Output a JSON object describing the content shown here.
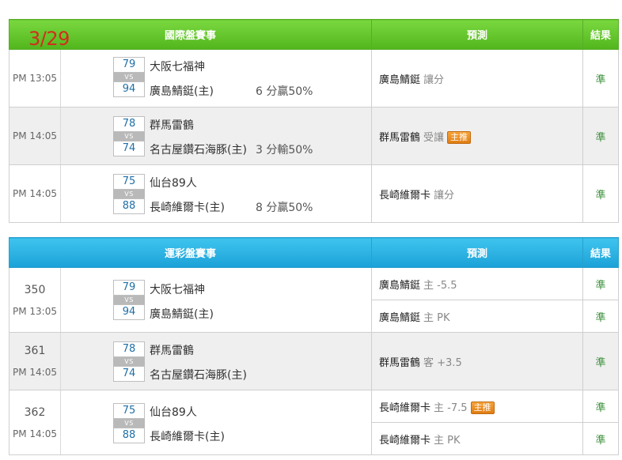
{
  "table1": {
    "date_mark": "3/29",
    "header": {
      "events": "國際盤賽事",
      "prediction": "預測",
      "result": "結果"
    },
    "rows": [
      {
        "time": "PM 13:05",
        "away_score": "79",
        "home_score": "94",
        "vs": "VS",
        "away": "大阪七福神",
        "home": "廣島鯖鋌(主)",
        "handicap": "6 分贏50%",
        "pick": "廣島鯖鋌",
        "pick_extra": "讓分",
        "badge": "",
        "result": "準"
      },
      {
        "time": "PM 14:05",
        "away_score": "78",
        "home_score": "74",
        "vs": "VS",
        "away": "群馬雷鶴",
        "home": "名古屋鑽石海豚(主)",
        "handicap": "3 分輸50%",
        "pick": "群馬雷鶴",
        "pick_extra": "受讓",
        "badge": "主推",
        "result": "準"
      },
      {
        "time": "PM 14:05",
        "away_score": "75",
        "home_score": "88",
        "vs": "VS",
        "away": "仙台89人",
        "home": "長崎維爾卡(主)",
        "handicap": "8 分贏50%",
        "pick": "長崎維爾卡",
        "pick_extra": "讓分",
        "badge": "",
        "result": "準"
      }
    ]
  },
  "table2": {
    "header": {
      "events": "運彩盤賽事",
      "prediction": "預測",
      "result": "結果"
    },
    "rows": [
      {
        "num": "350",
        "time": "PM 13:05",
        "away_score": "79",
        "home_score": "94",
        "vs": "VS",
        "away": "大阪七福神",
        "home": "廣島鯖鋌(主)",
        "picks": [
          {
            "team": "廣島鯖鋌",
            "extra": "主 -5.5",
            "badge": "",
            "result": "準"
          },
          {
            "team": "廣島鯖鋌",
            "extra": "主 PK",
            "badge": "",
            "result": "準"
          }
        ]
      },
      {
        "num": "361",
        "time": "PM 14:05",
        "away_score": "78",
        "home_score": "74",
        "vs": "VS",
        "away": "群馬雷鶴",
        "home": "名古屋鑽石海豚(主)",
        "picks": [
          {
            "team": "群馬雷鶴",
            "extra": "客 +3.5",
            "badge": "",
            "result": "準"
          }
        ]
      },
      {
        "num": "362",
        "time": "PM 14:05",
        "away_score": "75",
        "home_score": "88",
        "vs": "VS",
        "away": "仙台89人",
        "home": "長崎維爾卡(主)",
        "picks": [
          {
            "team": "長崎維爾卡",
            "extra": "主 -7.5",
            "badge": "主推",
            "result": "準"
          },
          {
            "team": "長崎維爾卡",
            "extra": "主 PK",
            "badge": "",
            "result": "準"
          }
        ]
      }
    ]
  }
}
